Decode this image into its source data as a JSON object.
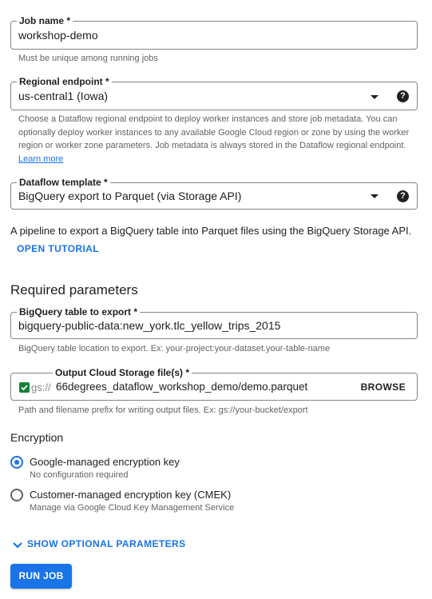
{
  "job_name": {
    "label": "Job name *",
    "value": "workshop-demo",
    "hint": "Must be unique among running jobs"
  },
  "regional_endpoint": {
    "label": "Regional endpoint *",
    "value": "us-central1 (Iowa)",
    "hint": "Choose a Dataflow regional endpoint to deploy worker instances and store job metadata. You can optionally deploy worker instances to any available Google Cloud region or zone by using the worker region or worker zone parameters. Job metadata is always stored in the Dataflow regional endpoint.",
    "learn_more": "Learn more"
  },
  "dataflow_template": {
    "label": "Dataflow template *",
    "value": "BigQuery export to Parquet (via Storage API)",
    "description": "A pipeline to export a BigQuery table into Parquet files using the BigQuery Storage API.",
    "open_tutorial": "OPEN TUTORIAL"
  },
  "required_parameters": {
    "heading": "Required parameters",
    "bq_table": {
      "label": "BigQuery table to export *",
      "value": "bigquery-public-data:new_york.tlc_yellow_trips_2015",
      "hint": "BigQuery table location to export. Ex: your-project:your-dataset.your-table-name"
    },
    "output_file": {
      "label": "Output Cloud Storage file(s) *",
      "prefix": "gs://",
      "value": "66degrees_dataflow_workshop_demo/demo.parquet",
      "browse": "BROWSE",
      "hint": "Path and filename prefix for writing output files. Ex: gs://your-bucket/export"
    }
  },
  "encryption": {
    "heading": "Encryption",
    "options": [
      {
        "label": "Google-managed encryption key",
        "sub": "No configuration required",
        "selected": true
      },
      {
        "label": "Customer-managed encryption key (CMEK)",
        "sub": "Manage via Google Cloud Key Management Service",
        "selected": false
      }
    ]
  },
  "show_optional": "SHOW OPTIONAL PARAMETERS",
  "run_job": "RUN JOB",
  "colors": {
    "accent": "#1a73e8",
    "check": "#188038",
    "button": "#1a73e8"
  }
}
